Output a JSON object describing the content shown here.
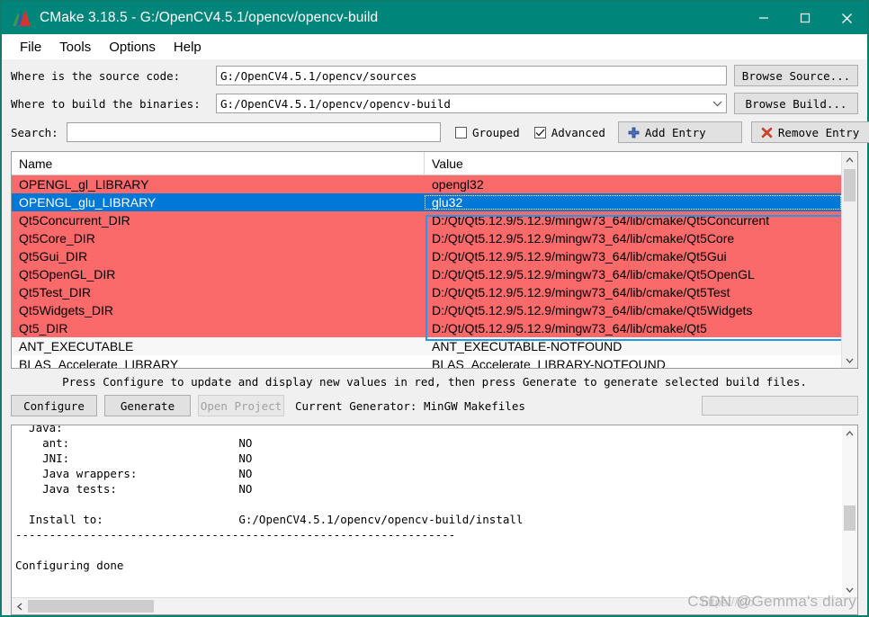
{
  "window": {
    "title": "CMake 3.18.5 - G:/OpenCV4.5.1/opencv/opencv-build",
    "app_icon": "cmake-triangle-icon",
    "minimize_label": "—",
    "maximize_label": "□",
    "close_label": "✕"
  },
  "menubar": {
    "items": [
      {
        "label": "File"
      },
      {
        "label": "Tools"
      },
      {
        "label": "Options"
      },
      {
        "label": "Help"
      }
    ]
  },
  "source_row": {
    "label": "Where is the source code:",
    "value": "G:/OpenCV4.5.1/opencv/sources",
    "placeholder": "",
    "button": "Browse Source..."
  },
  "build_row": {
    "label": "Where to build the binaries:",
    "value": "G:/OpenCV4.5.1/opencv/opencv-build",
    "placeholder": "",
    "button": "Browse Build..."
  },
  "search_row": {
    "label": "Search:",
    "value": "",
    "placeholder": "",
    "grouped_label": "Grouped",
    "grouped_checked": false,
    "advanced_label": "Advanced",
    "advanced_checked": true,
    "add_entry_label": "Add Entry",
    "remove_entry_label": "Remove Entry"
  },
  "table": {
    "columns": [
      "Name",
      "Value"
    ],
    "rows": [
      {
        "name": "OPENGL_gl_LIBRARY",
        "value": "opengl32",
        "state": "new"
      },
      {
        "name": "OPENGL_glu_LIBRARY",
        "value": "glu32",
        "state": "selected"
      },
      {
        "name": "Qt5Concurrent_DIR",
        "value": "D:/Qt/Qt5.12.9/5.12.9/mingw73_64/lib/cmake/Qt5Concurrent",
        "state": "new"
      },
      {
        "name": "Qt5Core_DIR",
        "value": "D:/Qt/Qt5.12.9/5.12.9/mingw73_64/lib/cmake/Qt5Core",
        "state": "new"
      },
      {
        "name": "Qt5Gui_DIR",
        "value": "D:/Qt/Qt5.12.9/5.12.9/mingw73_64/lib/cmake/Qt5Gui",
        "state": "new"
      },
      {
        "name": "Qt5OpenGL_DIR",
        "value": "D:/Qt/Qt5.12.9/5.12.9/mingw73_64/lib/cmake/Qt5OpenGL",
        "state": "new"
      },
      {
        "name": "Qt5Test_DIR",
        "value": "D:/Qt/Qt5.12.9/5.12.9/mingw73_64/lib/cmake/Qt5Test",
        "state": "new"
      },
      {
        "name": "Qt5Widgets_DIR",
        "value": "D:/Qt/Qt5.12.9/5.12.9/mingw73_64/lib/cmake/Qt5Widgets",
        "state": "new"
      },
      {
        "name": "Qt5_DIR",
        "value": "D:/Qt/Qt5.12.9/5.12.9/mingw73_64/lib/cmake/Qt5",
        "state": "new"
      },
      {
        "name": "ANT_EXECUTABLE",
        "value": "ANT_EXECUTABLE-NOTFOUND",
        "state": "plain"
      },
      {
        "name": "BLAS_Accelerate_LIBRARY",
        "value": "BLAS_Accelerate_LIBRARY-NOTFOUND",
        "state": "plain"
      }
    ]
  },
  "hint": "Press Configure to update and display new values in red, then press Generate to generate selected build files.",
  "actions": {
    "configure_label": "Configure",
    "generate_label": "Generate",
    "open_project_label": "Open Project",
    "open_project_enabled": false,
    "generator_text": "Current Generator: MinGW Makefiles",
    "progress_value": 0
  },
  "log": {
    "text": "  Java:\n    ant:                         NO\n    JNI:                         NO\n    Java wrappers:               NO\n    Java tests:                  NO\n\n  Install to:                    G:/OpenCV4.5.1/opencv/opencv-build/install\n-----------------------------------------------------------------\n\nConfiguring done"
  },
  "watermark": {
    "url": "https://blo",
    "text": "CSDN @Gemma's diary"
  },
  "colors": {
    "titlebar": "#00857a",
    "new_value_red": "#fb6a6a",
    "selection_blue": "#0078d7",
    "focus_outline": "#1e9bef",
    "window_border": "#0f7d6e"
  }
}
